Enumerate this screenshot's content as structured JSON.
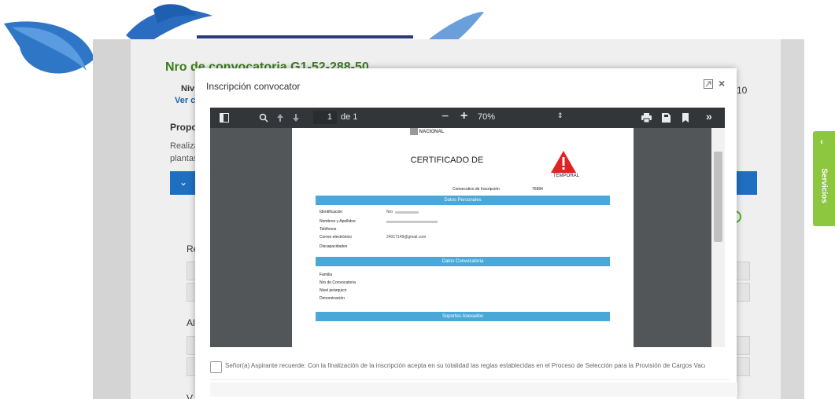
{
  "background": {
    "title": "Nro de convocatoria G1-52-288-50",
    "nivel_partial": "Niv",
    "ver_partial": "Ver c",
    "number_partial": "10",
    "propos_partial": "Propos",
    "realizar_partial": "Realizar",
    "plantas_partial": "plantas",
    "re_partial": "Re",
    "alt_partial": "Alt",
    "v_partial": "V"
  },
  "servicios_tab": {
    "label": "Servicios",
    "arrow": "‹"
  },
  "modal": {
    "title": "Inscripción convocatoria",
    "close_glyph": "×"
  },
  "pdf_toolbar": {
    "page_current": "1",
    "page_total": "de 1",
    "zoom": "70%",
    "zoom_out": "−",
    "zoom_in": "+",
    "more": "»"
  },
  "document": {
    "logo_text": "NACIONAL",
    "title": "CERTIFICADO DE",
    "warning_label": "TEMPORAL",
    "consecutivo_label": "Consecutivo de Inscripción",
    "consecutivo_value": "76884",
    "section_personales": "Datos Personales",
    "section_convocatoria": "Datos Convocatoria",
    "section_soportes": "Soportes Anexados",
    "fields_personales": [
      {
        "label": "Identificación",
        "value": "Nro"
      },
      {
        "label": "Nombres y Apellidos",
        "value": ""
      },
      {
        "label": "Teléfonos",
        "value": ""
      },
      {
        "label": "Correo electrónico",
        "value": "24017149@gmail.com"
      },
      {
        "label": "Discapacidades",
        "value": ""
      }
    ],
    "fields_convocatoria": [
      {
        "label": "Familia"
      },
      {
        "label": "Nro de Convocatoria"
      },
      {
        "label": "Nivel jerárquico"
      },
      {
        "label": "Denominación"
      }
    ]
  },
  "footer": {
    "notice": "Señor(a) Aspirante recuerde: Con la finalización de la inscripción acepta en su totalidad las reglas establecidas en el Proceso de Selección para la Provisión de Cargos Vacantes de"
  },
  "colors": {
    "modal_band": "#4aa8d8",
    "servicios": "#8dc63f",
    "title_green": "#3a7d1e",
    "bluebar": "#1f6fc0"
  }
}
